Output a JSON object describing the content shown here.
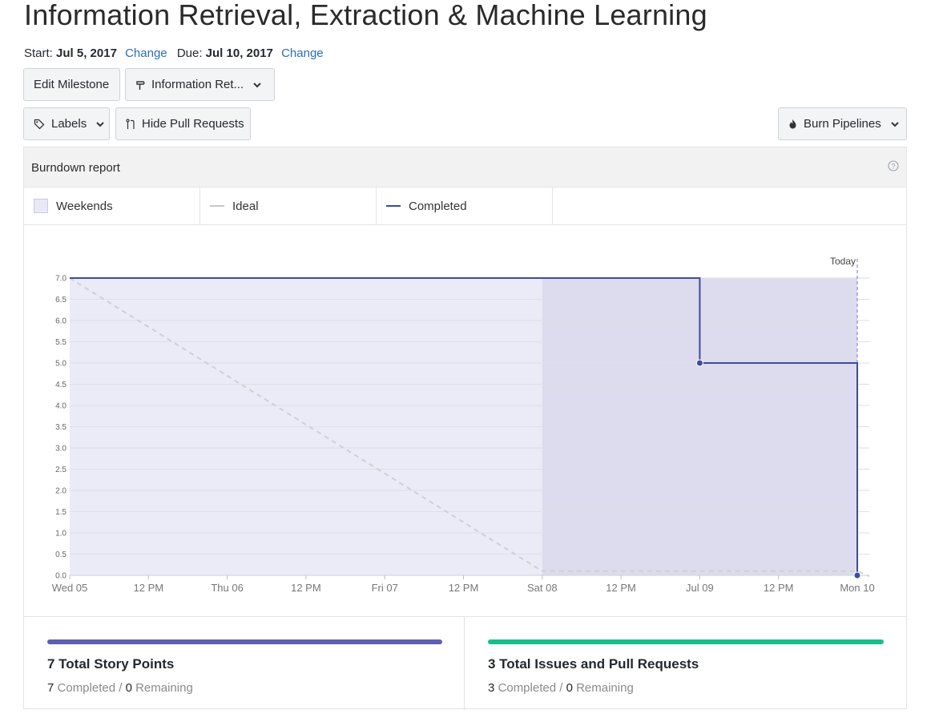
{
  "page_title": "Information Retrieval, Extraction & Machine Learning",
  "dates": {
    "start_label": "Start:",
    "start_value": "Jul 5, 2017",
    "start_change": "Change",
    "due_label": "Due:",
    "due_value": "Jul 10, 2017",
    "due_change": "Change"
  },
  "toolbar": {
    "edit_milestone": "Edit Milestone",
    "milestone_select": "Information Ret...",
    "labels": "Labels",
    "hide_pull_requests": "Hide Pull Requests",
    "burn_pipelines": "Burn Pipelines"
  },
  "report": {
    "title": "Burndown report",
    "legend": {
      "weekends": "Weekends",
      "ideal": "Ideal",
      "completed": "Completed"
    }
  },
  "colors": {
    "completed": "#3f4ba0",
    "ideal": "#cfcfd6",
    "weekend_fill": "#dcdcee",
    "chart_fill": "#ebebf7",
    "today_line": "#8b86e6",
    "story_bar": "#5b60b6",
    "issues_bar": "#17c08b"
  },
  "chart_data": {
    "type": "line",
    "title": "",
    "x_unit": "days since Wed 05 00:00",
    "x_tick_labels": [
      "Wed 05",
      "12 PM",
      "Thu 06",
      "12 PM",
      "Fri 07",
      "12 PM",
      "Sat 08",
      "12 PM",
      "Jul 09",
      "12 PM",
      "Mon 10"
    ],
    "x_ticks": [
      0,
      0.5,
      1,
      1.5,
      2,
      2.5,
      3,
      3.5,
      4,
      4.5,
      5
    ],
    "xlim": [
      0,
      5
    ],
    "ylim": [
      0,
      7
    ],
    "y_ticks": [
      "0.0",
      "0.5",
      "1.0",
      "1.5",
      "2.0",
      "2.5",
      "3.0",
      "3.5",
      "4.0",
      "4.5",
      "5.0",
      "5.5",
      "6.0",
      "6.5",
      "7.0"
    ],
    "grid": true,
    "weekend_range": [
      3,
      5
    ],
    "today_label": "Today",
    "today_x": 5,
    "series": [
      {
        "name": "Ideal",
        "style": "dashed",
        "points": [
          [
            0,
            7
          ],
          [
            3,
            0.1
          ],
          [
            5,
            0.1
          ]
        ]
      },
      {
        "name": "Completed",
        "style": "step",
        "points": [
          [
            0,
            7
          ],
          [
            4,
            7
          ],
          [
            4,
            5
          ],
          [
            5,
            5
          ],
          [
            5,
            0
          ]
        ],
        "markers": [
          [
            4,
            5
          ],
          [
            5,
            0
          ]
        ]
      }
    ]
  },
  "stats": {
    "story_points": {
      "title": "7 Total Story Points",
      "completed": "7",
      "completed_label": "Completed /",
      "remaining": "0",
      "remaining_label": "Remaining"
    },
    "issues": {
      "title": "3 Total Issues and Pull Requests",
      "completed": "3",
      "completed_label": "Completed /",
      "remaining": "0",
      "remaining_label": "Remaining"
    }
  }
}
